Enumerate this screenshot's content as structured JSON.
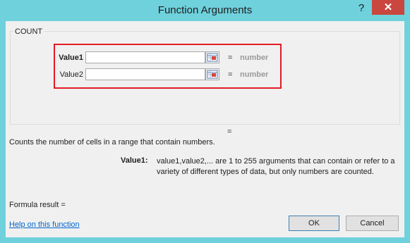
{
  "window": {
    "title": "Function Arguments",
    "help_glyph": "?",
    "close_glyph": "✕"
  },
  "function": {
    "name": "COUNT",
    "args": [
      {
        "label": "Value1",
        "value": "",
        "result": "number"
      },
      {
        "label": "Value2",
        "value": "",
        "result": "number"
      }
    ],
    "overall_result": "="
  },
  "description": {
    "summary": "Counts the number of cells in a range that contain numbers.",
    "arg_label": "Value1:",
    "arg_text": "value1,value2,... are 1 to 255 arguments that can contain or refer to a variety of different types of data, but only numbers are counted."
  },
  "footer": {
    "formula_result_label": "Formula result =",
    "help_link": "Help on this function",
    "ok_label": "OK",
    "cancel_label": "Cancel"
  },
  "colors": {
    "titlebar": "#6fd1dc",
    "close": "#c9473e",
    "highlight": "#e31b23",
    "link": "#0066cc"
  }
}
